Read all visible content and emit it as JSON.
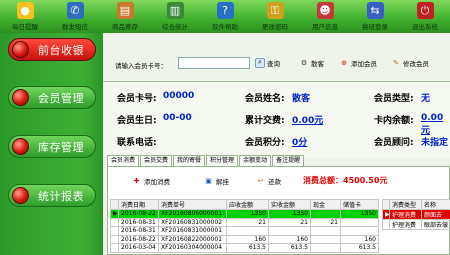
{
  "toolbar": [
    {
      "label": "每日提醒",
      "icon": "bulb-icon",
      "color": "#f7c21c"
    },
    {
      "label": "群发短信",
      "icon": "phone-icon",
      "color": "#2f6dbd"
    },
    {
      "label": "商品寄存",
      "icon": "box-icon",
      "color": "#c87a2a"
    },
    {
      "label": "综合统计",
      "icon": "chart-icon",
      "color": "#3a8a3a"
    },
    {
      "label": "软件帮助",
      "icon": "help-icon",
      "color": "#2b6ec6"
    },
    {
      "label": "更改密码",
      "icon": "lock-icon",
      "color": "#d0a020"
    },
    {
      "label": "用户信息",
      "icon": "user-icon",
      "color": "#c83838"
    },
    {
      "label": "换班登录",
      "icon": "login-icon",
      "color": "#3a5fc4"
    },
    {
      "label": "退出系统",
      "icon": "exit-icon",
      "color": "#c02020"
    }
  ],
  "sidebar": [
    {
      "label": "前台收银",
      "active": true
    },
    {
      "label": "会员管理",
      "active": false
    },
    {
      "label": "库存管理",
      "active": false
    },
    {
      "label": "统计报表",
      "active": false
    }
  ],
  "search": {
    "label": "请输入会员卡号：",
    "value": "",
    "buttons": [
      {
        "label": "查询",
        "icon": "search-icon"
      },
      {
        "label": "散客",
        "icon": "guest-icon"
      },
      {
        "label": "添加会员",
        "icon": "add-member-icon"
      },
      {
        "label": "修改会员",
        "icon": "edit-member-icon"
      }
    ]
  },
  "member": {
    "card_label": "会员卡号:",
    "card_value": "00000",
    "name_label": "会员姓名:",
    "name_value": "散客",
    "type_label": "会员类型:",
    "type_value": "无",
    "birthday_label": "会员生日:",
    "birthday_value": "00-00",
    "spend_label": "累计交费:",
    "spend_value": "0.00元",
    "balance_label": "卡内余额:",
    "balance_value": "0.00元",
    "phone_label": "联系电话:",
    "phone_value": "",
    "points_label": "会员积分:",
    "points_value": "0分",
    "consultant_label": "会员顾问:",
    "consultant_value": "未指定"
  },
  "tabs": [
    "会员消费",
    "会员交费",
    "我的寄餐",
    "积分管理",
    "余额变动",
    "备注提醒"
  ],
  "actions": [
    {
      "label": "添加消费",
      "icon": "plus-icon"
    },
    {
      "label": "解挂",
      "icon": "unhang-icon"
    },
    {
      "label": "还款",
      "icon": "repay-icon"
    }
  ],
  "total_label": "消费总额：",
  "total_value": "4500.50元",
  "sales": {
    "headers": [
      "",
      "消费日期",
      "消费单号",
      "应收金额",
      "实收金额",
      "现金",
      "储值卡"
    ],
    "rows": [
      [
        "▶",
        "2016-08-22",
        "XF20160806000001",
        "1350",
        "1350",
        "",
        "1350"
      ],
      [
        "",
        "2016-08-31",
        "XF20160831000002",
        "21",
        "21",
        "21",
        ""
      ],
      [
        "",
        "2016-08-31",
        "XF20160831000001",
        "",
        "",
        "",
        ""
      ],
      [
        "",
        "2016-08-22",
        "XF20160822000001",
        "160",
        "160",
        "",
        "160"
      ],
      [
        "",
        "2016-03-04",
        "XF20160304000004",
        "613.5",
        "613.5",
        "",
        "613.5"
      ]
    ]
  },
  "detail": {
    "headers": [
      "",
      "消费类型",
      "名称"
    ],
    "rows": [
      [
        "▶",
        "护理消费",
        "颜面去"
      ],
      [
        "",
        "护理消费",
        "眼部去皱"
      ]
    ]
  }
}
